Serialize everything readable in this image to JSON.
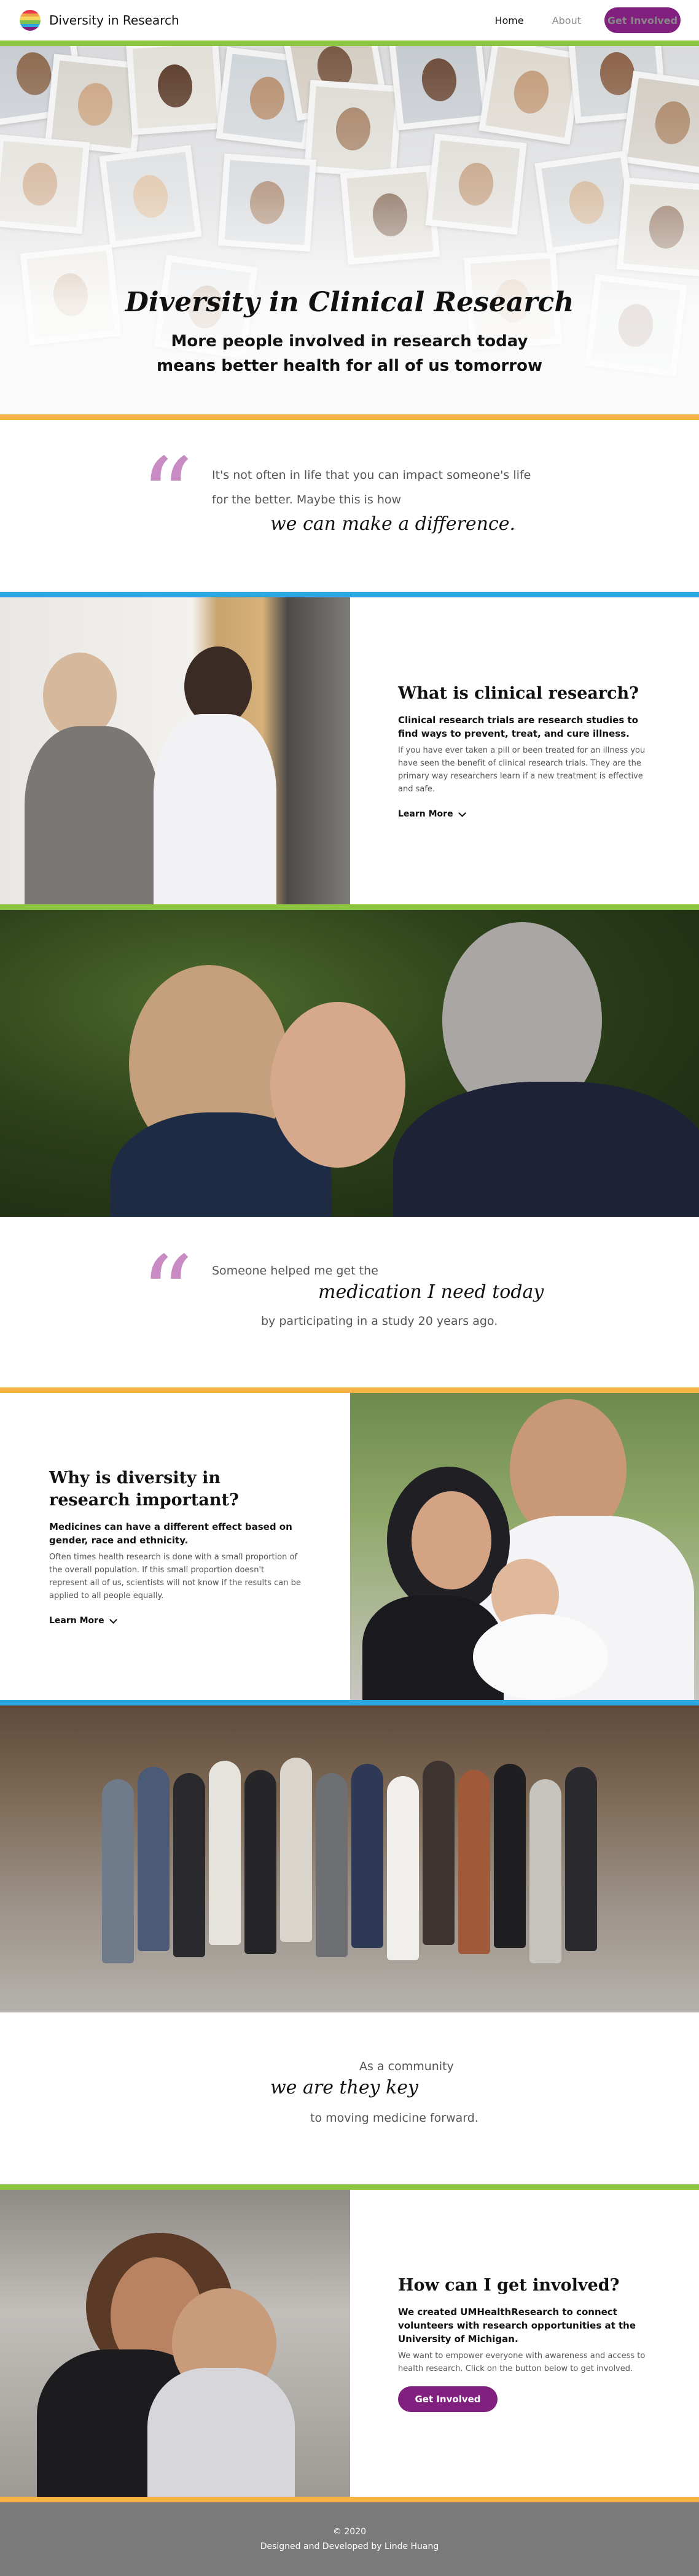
{
  "header": {
    "brand": "Diversity in Research",
    "nav": [
      {
        "label": "Home",
        "active": true
      },
      {
        "label": "About",
        "active": false
      }
    ],
    "cta": "Get Involved",
    "logo_colors": [
      "#e63946",
      "#f4a24c",
      "#f6d55c",
      "#7dc24b",
      "#2fa3de",
      "#822080"
    ]
  },
  "colors": {
    "purple": "#822080",
    "green": "#8cc63f",
    "orange": "#f7b244",
    "blue": "#29a8df",
    "highlight": "#e8c3e4"
  },
  "hero": {
    "title": "Diversity in Clinical Research",
    "subtitle_line1": "More people involved in research today",
    "subtitle_line2": "means better health for all of us tomorrow"
  },
  "quote1": {
    "line1": "It's not often in life that you can impact someone's life",
    "line2": "for the better. Maybe this is how",
    "highlight": "we can make a difference."
  },
  "section1": {
    "title": "What is clinical research?",
    "lead": "Clinical research trials are research studies to find ways to prevent, treat, and cure illness.",
    "body": "If you have ever taken a pill or been treated for an illness you have seen the benefit of clinical research trials. They are the primary way researchers learn if a new treatment is effective and safe.",
    "link": "Learn More"
  },
  "quote2": {
    "line1": "Someone helped me get the",
    "highlight": "medication I need today",
    "line2": "by participating in a study 20 years ago."
  },
  "section2": {
    "title": "Why is diversity in research important?",
    "lead": "Medicines can have a different effect based on gender, race and ethnicity.",
    "body": "Often times health research is done with a small proportion of the overall population. If this small proportion doesn't represent all of us, scientists will not know if the results can be applied to all people equally.",
    "link": "Learn More"
  },
  "quote3": {
    "line1": "As a community",
    "highlight": "we are they key",
    "line2": "to moving medicine forward."
  },
  "section3": {
    "title": "How can I get involved?",
    "lead": "We created UMHealthResearch to connect volunteers with research opportunities at the University of Michigan.",
    "body": "We want to empower everyone with awareness and access to health research. Click on the button below to get involved.",
    "button": "Get Involved"
  },
  "footer": {
    "year": "© 2020",
    "credit": "Designed and Developed by Linde Huang"
  }
}
